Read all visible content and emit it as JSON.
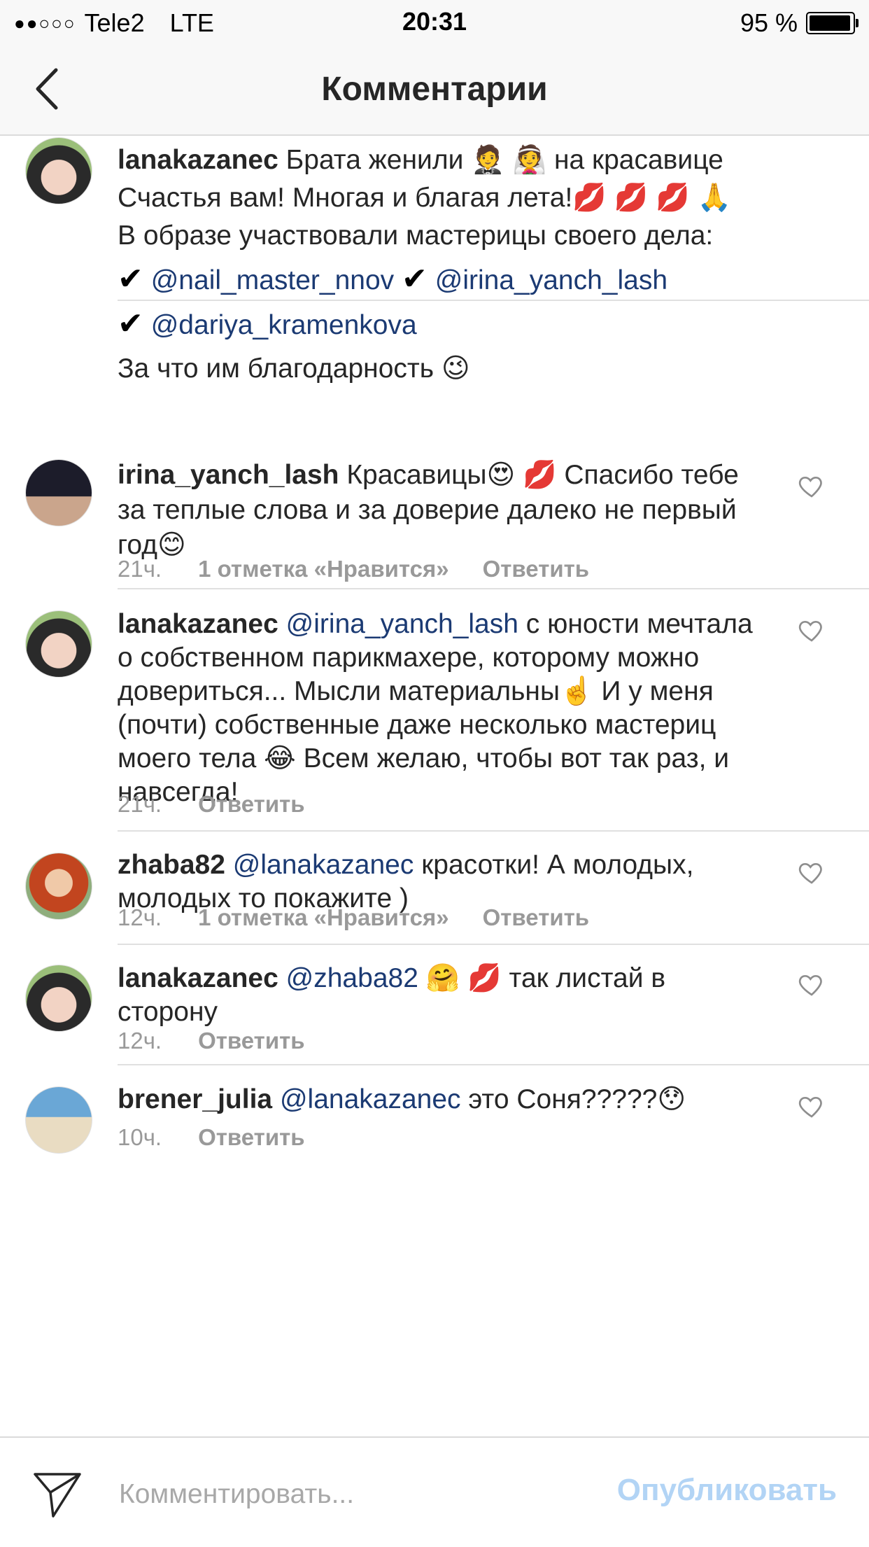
{
  "status_bar": {
    "signal": "●●○○○",
    "carrier": "Tele2",
    "network": "LTE",
    "time": "20:31",
    "battery": "95 %",
    "battery_level": 0.95
  },
  "header": {
    "title": "Комментарии"
  },
  "comments": [
    {
      "username": "lanakazanec",
      "lines": [
        "Брата женили 🤵 👰  на красавице",
        "Счастья вам! Многая и благая лета!💋 💋 💋 🙏",
        "В образе участвовали мастерицы своего дела:"
      ],
      "check": "✔",
      "mentions": [
        "@nail_master_nnov",
        "@irina_yanch_lash",
        "@dariya_kramenkova"
      ],
      "last_line": "За что им благодарность 😉"
    },
    {
      "username": "irina_yanch_lash",
      "text": "Красавицы😍 💋  Спасибо тебе за теплые слова и за доверие далеко не первый год😊",
      "time": "21ч.",
      "likes": "1 отметка «Нравится»",
      "reply": "Ответить"
    },
    {
      "username": "lanakazanec",
      "mention": "@irina_yanch_lash",
      "text": "с юности мечтала о собственном парикмахере, которому можно довериться... Мысли материальны☝️  И у меня (почти) собственные  даже несколько мастериц моего тела 😂  Всем желаю, чтобы вот так раз, и навсегда!",
      "time": "21ч.",
      "reply": "Ответить"
    },
    {
      "username": "zhaba82",
      "mention": "@lanakazanec",
      "text": "красотки! А молодых, молодых то покажите )",
      "time": "12ч.",
      "likes": "1 отметка «Нравится»",
      "reply": "Ответить"
    },
    {
      "username": "lanakazanec",
      "mention": "@zhaba82",
      "text": "🤗 💋  так листай в сторону",
      "time": "12ч.",
      "reply": "Ответить"
    },
    {
      "username": "brener_julia",
      "mention": "@lanakazanec",
      "text": "это Соня?????😯",
      "time": "10ч.",
      "reply": "Ответить"
    }
  ],
  "composer": {
    "placeholder": "Комментировать...",
    "publish_label": "Опубликовать"
  },
  "colors": {
    "mention": "#1b3a73",
    "publish_disabled": "#b2d4f5",
    "meta": "#999999"
  },
  "icons": {
    "back": "chevron-left-icon",
    "like": "heart-outline-icon",
    "send": "paper-plane-icon"
  }
}
